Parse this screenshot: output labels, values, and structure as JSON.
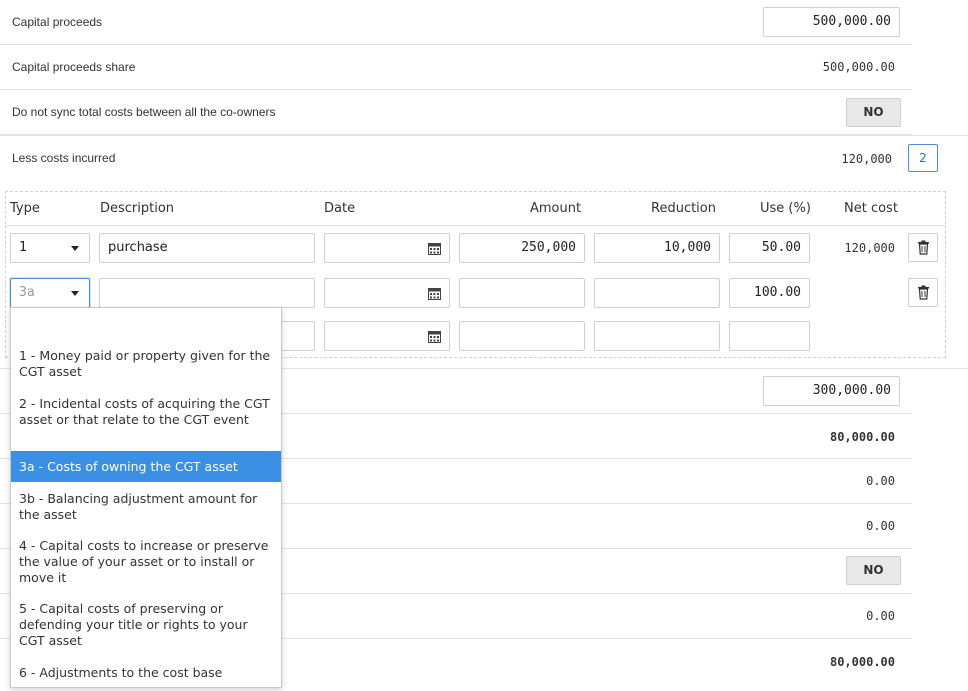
{
  "rows": {
    "capital_proceeds": {
      "label": "Capital proceeds",
      "value": "500,000.00"
    },
    "capital_proceeds_share": {
      "label": "Capital proceeds share",
      "value": "500,000.00"
    },
    "no_sync": {
      "label": "Do not sync total costs between all the co-owners",
      "toggle": "NO"
    },
    "less_costs": {
      "label": "Less costs incurred",
      "value": "120,000",
      "count": "2"
    }
  },
  "table": {
    "headers": [
      "Type",
      "Description",
      "Date",
      "Amount",
      "Reduction",
      "Use (%)",
      "Net cost"
    ],
    "rows": [
      {
        "type": "1",
        "description": "purchase",
        "date": "",
        "amount": "250,000",
        "reduction": "10,000",
        "use": "50.00",
        "net_cost": "120,000"
      },
      {
        "type": "3a",
        "description": "",
        "date": "",
        "amount": "",
        "reduction": "",
        "use": "100.00",
        "net_cost": ""
      },
      {
        "type": "",
        "description": "",
        "date": "",
        "amount": "",
        "reduction": "",
        "use": "",
        "net_cost": ""
      }
    ]
  },
  "dropdown": {
    "options": [
      {
        "label": "1 - Money paid or property given for the CGT asset"
      },
      {
        "label": "2 - Incidental costs of acquiring the CGT asset or that relate to the CGT event"
      },
      {
        "label": "3a - Costs of owning the CGT asset"
      },
      {
        "label": "3b - Balancing adjustment amount for the asset"
      },
      {
        "label": "4 - Capital costs to increase or preserve the value of your asset or to install or move it"
      },
      {
        "label": "5 - Capital costs of preserving or defending your title or rights to your CGT asset"
      },
      {
        "label": "6 - Adjustments to the cost base"
      }
    ],
    "selected_index": 2
  },
  "lower": {
    "field_value": "300,000.00",
    "v1": "80,000.00",
    "v2": "0.00",
    "v3": "0.00",
    "toggle": "NO",
    "v4": "0.00",
    "v5": "80,000.00"
  },
  "colors": {
    "accent": "#3b8fe4",
    "border": "#cfcfcf"
  }
}
